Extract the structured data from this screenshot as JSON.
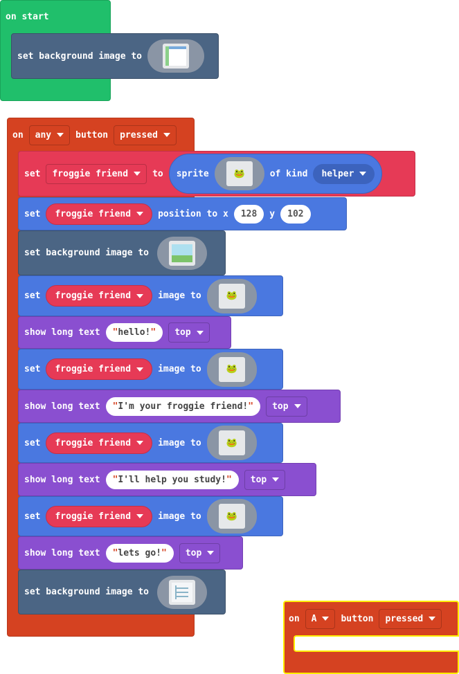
{
  "on_start": {
    "label": "on start",
    "set_bg": {
      "label": "set background image to",
      "image_icon": "background-image-1"
    }
  },
  "any_button": {
    "on": "on",
    "button_value": "any",
    "button": "button",
    "event_value": "pressed",
    "set_sprite": {
      "set": "set",
      "variable": "froggie friend",
      "to": "to",
      "sprite": "sprite",
      "of_kind": "of kind",
      "kind": "helper",
      "image_icon": "frog-image"
    },
    "set_position": {
      "set": "set",
      "variable": "froggie friend",
      "position_to_x": "position to x",
      "x": "128",
      "y_label": "y",
      "y": "102"
    },
    "set_bg1": {
      "label": "set background image to",
      "image_icon": "background-image-2"
    },
    "steps": [
      {
        "set": "set",
        "variable": "froggie friend",
        "image_to": "image to",
        "text_label": "show long text",
        "text": "hello!",
        "position": "top"
      },
      {
        "set": "set",
        "variable": "froggie friend",
        "image_to": "image to",
        "text_label": "show long text",
        "text": "I'm your froggie friend!",
        "position": "top"
      },
      {
        "set": "set",
        "variable": "froggie friend",
        "image_to": "image to",
        "text_label": "show long text",
        "text": "I'll help you study!",
        "position": "top"
      },
      {
        "set": "set",
        "variable": "froggie friend",
        "image_to": "image to",
        "text_label": "show long text",
        "text": "lets go!",
        "position": "top"
      }
    ],
    "set_bg2": {
      "label": "set background image to",
      "image_icon": "background-image-3"
    }
  },
  "a_button": {
    "on": "on",
    "button_value": "A",
    "button": "button",
    "event_value": "pressed"
  },
  "colors": {
    "events": "#20bf6b",
    "scene": "#4b6584",
    "controller": "#d54221",
    "variables": "#e63a56",
    "sprites": "#4a78e0",
    "game": "#8a4fd0",
    "highlight": "#ffee00"
  }
}
